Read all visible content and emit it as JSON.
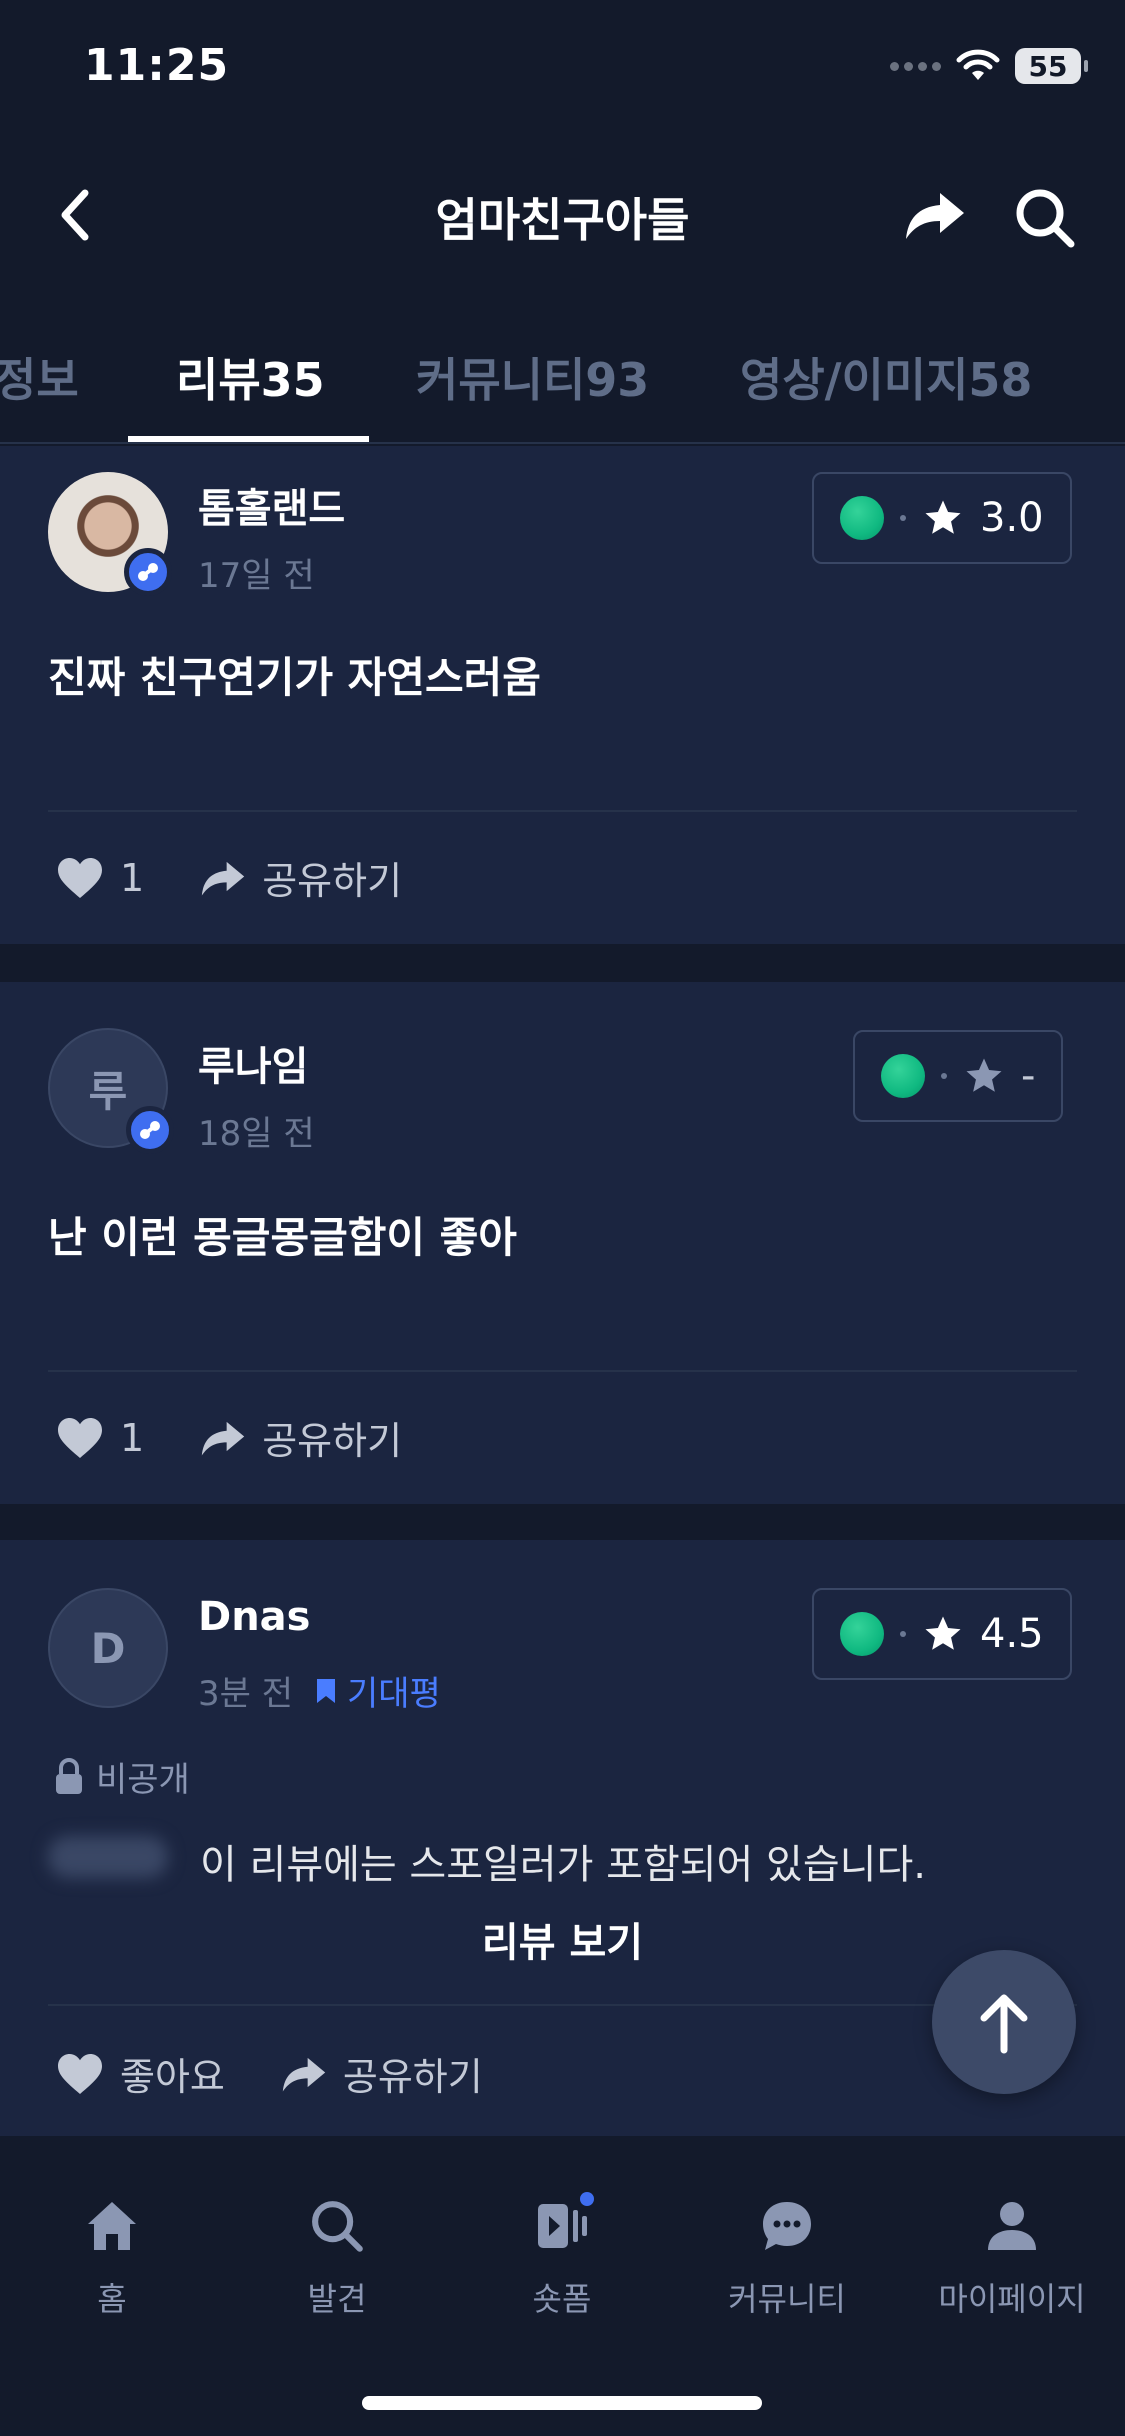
{
  "status": {
    "time": "11:25",
    "battery": "55"
  },
  "header": {
    "title": "엄마친구아들"
  },
  "tabs": [
    {
      "label": "정보",
      "active": false
    },
    {
      "label": "리뷰35",
      "active": true
    },
    {
      "label": "커뮤니티93",
      "active": false
    },
    {
      "label": "영상/이미지58",
      "active": false
    }
  ],
  "reviews": [
    {
      "username": "톰홀랜드",
      "time": "17일 전",
      "avatar_initial": "",
      "rating": "3.0",
      "text": "진짜 친구연기가 자연스러움",
      "likes": "1",
      "share_label": "공유하기"
    },
    {
      "username": "루나임",
      "time": "18일 전",
      "avatar_initial": "루",
      "rating": "-",
      "text": "난 이런 몽글몽글함이 좋아",
      "likes": "1",
      "share_label": "공유하기"
    },
    {
      "username": "Dnas",
      "time": "3분 전",
      "tag": "기대평",
      "avatar_initial": "D",
      "rating": "4.5",
      "private_label": "비공개",
      "spoiler_text": "이 리뷰에는 스포일러가 포함되어 있습니다.",
      "view_label": "리뷰 보기",
      "like_label": "좋아요",
      "share_label": "공유하기"
    }
  ],
  "bottom_nav": [
    {
      "label": "홈",
      "icon": "home-icon"
    },
    {
      "label": "발견",
      "icon": "search-icon"
    },
    {
      "label": "숏폼",
      "icon": "shortform-icon"
    },
    {
      "label": "커뮤니티",
      "icon": "chat-icon"
    },
    {
      "label": "마이페이지",
      "icon": "person-icon"
    }
  ],
  "colors": {
    "background": "#131a2b",
    "card": "#1b2540",
    "accent": "#3f6ef0",
    "rating_green": "#10b981"
  }
}
